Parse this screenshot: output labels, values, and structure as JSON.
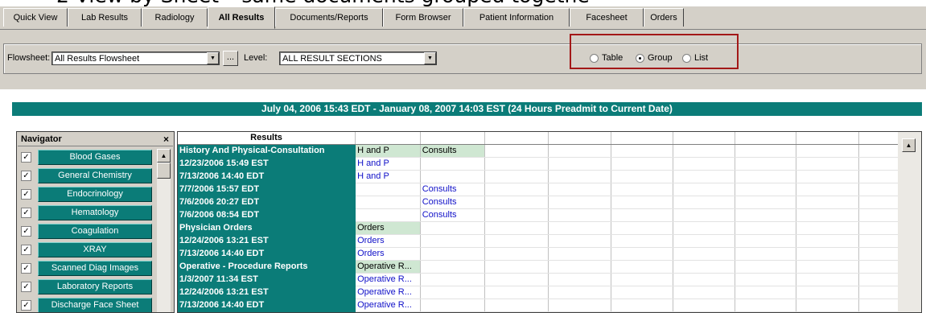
{
  "title_partial": "2 View by Sheet – same documents grouped togethe",
  "tabs": [
    {
      "label": "Quick View",
      "active": false
    },
    {
      "label": "Lab Results",
      "active": false
    },
    {
      "label": "Radiology",
      "active": false
    },
    {
      "label": "All Results",
      "active": true
    },
    {
      "label": "Documents/Reports",
      "active": false
    },
    {
      "label": "Form Browser",
      "active": false
    },
    {
      "label": "Patient Information",
      "active": false
    },
    {
      "label": "Facesheet",
      "active": false
    },
    {
      "label": "Orders",
      "active": false
    }
  ],
  "toolbar": {
    "flowsheet_label": "Flowsheet:",
    "flowsheet_value": "All Results Flowsheet",
    "ellipsis_label": "...",
    "level_label": "Level:",
    "level_value": "ALL RESULT SECTIONS",
    "view_options": [
      {
        "label": "Table",
        "checked": false
      },
      {
        "label": "Group",
        "checked": true
      },
      {
        "label": "List",
        "checked": false
      }
    ],
    "highlight_color": "#a31818"
  },
  "banner": {
    "text": "July 04, 2006 15:43 EDT - January 08, 2007 14:03 EST (24 Hours Preadmit to Current Date)"
  },
  "navigator": {
    "title": "Navigator",
    "close_label": "×",
    "items": [
      {
        "label": "Blood Gases",
        "checked": true
      },
      {
        "label": "General Chemistry",
        "checked": true
      },
      {
        "label": "Endocrinology",
        "checked": true
      },
      {
        "label": "Hematology",
        "checked": true
      },
      {
        "label": "Coagulation",
        "checked": true
      },
      {
        "label": "XRAY",
        "checked": true
      },
      {
        "label": "Scanned Diag Images",
        "checked": true
      },
      {
        "label": "Laboratory Reports",
        "checked": true
      },
      {
        "label": "Discharge Face Sheet",
        "checked": true
      }
    ]
  },
  "results": {
    "header": "Results",
    "rows": [
      {
        "label": "History And Physical-Consultation",
        "group": true,
        "c1": "H and P",
        "c2": "Consults"
      },
      {
        "label": "12/23/2006 15:49 EST",
        "group": false,
        "c1": "H and P",
        "c2": ""
      },
      {
        "label": "7/13/2006 14:40 EDT",
        "group": false,
        "c1": "H and P",
        "c2": ""
      },
      {
        "label": "7/7/2006 15:57 EDT",
        "group": false,
        "c1": "",
        "c2": "Consults"
      },
      {
        "label": "7/6/2006 20:27 EDT",
        "group": false,
        "c1": "",
        "c2": "Consults"
      },
      {
        "label": "7/6/2006 08:54 EDT",
        "group": false,
        "c1": "",
        "c2": "Consults"
      },
      {
        "label": "Physician Orders",
        "group": true,
        "c1": "Orders",
        "c2": ""
      },
      {
        "label": "12/24/2006 13:21 EST",
        "group": false,
        "c1": "Orders",
        "c2": ""
      },
      {
        "label": "7/13/2006 14:40 EDT",
        "group": false,
        "c1": "Orders",
        "c2": ""
      },
      {
        "label": "Operative - Procedure Reports",
        "group": true,
        "c1": "Operative R...",
        "c2": ""
      },
      {
        "label": "1/3/2007 11:34 EST",
        "group": false,
        "c1": "Operative R...",
        "c2": ""
      },
      {
        "label": "12/24/2006 13:21 EST",
        "group": false,
        "c1": "Operative R...",
        "c2": ""
      },
      {
        "label": "7/13/2006 14:40 EDT",
        "group": false,
        "c1": "Operative R...",
        "c2": ""
      }
    ],
    "colors": {
      "row_head": "#0b7c78",
      "group_cell": "#cfe7d2",
      "link": "#1010c8"
    }
  }
}
